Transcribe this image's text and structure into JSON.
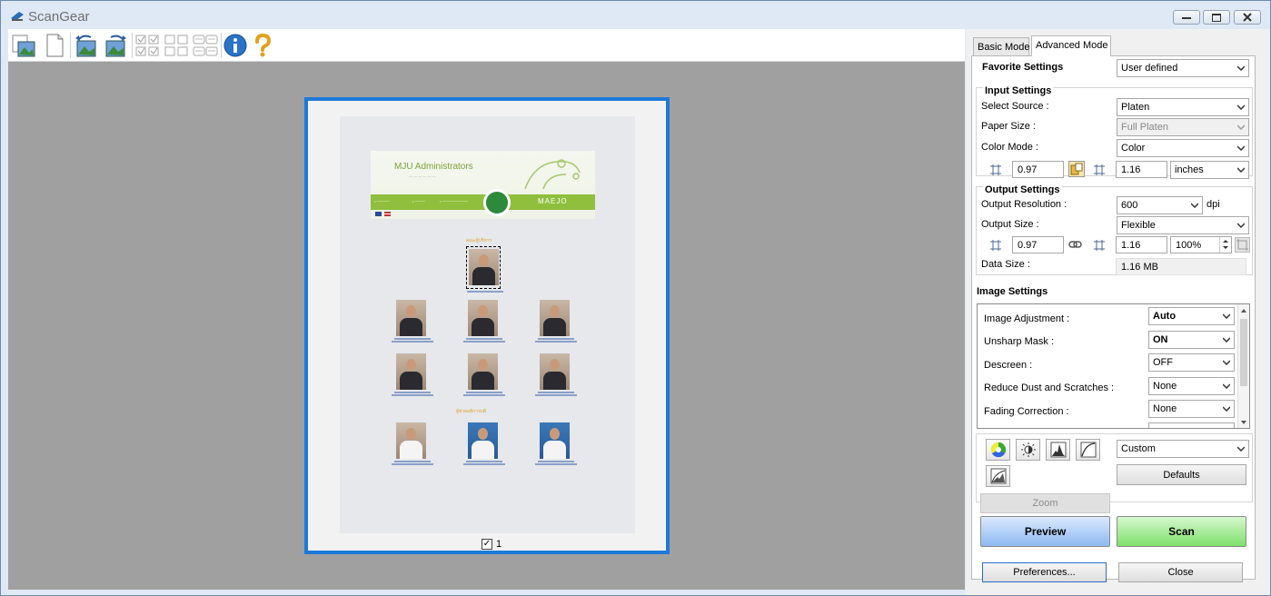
{
  "window": {
    "title": "ScanGear"
  },
  "toolbar": {
    "icons": [
      "scan-to-image-icon",
      "blank-page-icon",
      "rotate-left-icon",
      "rotate-right-icon",
      "thumbnail-select-icon",
      "thumbnail-clear-icon",
      "thumbnail-layout-icon",
      "info-icon",
      "help-icon"
    ]
  },
  "preview": {
    "frame_number": "1",
    "frame_checked": true,
    "document": {
      "banner_title": "MJU Administrators",
      "banner_brand": "MAEJO",
      "section1": "คณะผู้บริหาร",
      "section2": "ผู้ช่วยอธิการบดี"
    }
  },
  "panel": {
    "tabs": [
      {
        "label": "Basic Mode",
        "active": false
      },
      {
        "label": "Advanced Mode",
        "active": true
      }
    ],
    "favorite": {
      "label": "Favorite Settings",
      "value": "User defined"
    },
    "input": {
      "title": "Input Settings",
      "source_label": "Select Source :",
      "source_value": "Platen",
      "paper_label": "Paper Size :",
      "paper_value": "Full Platen",
      "color_label": "Color Mode :",
      "color_value": "Color",
      "width": "0.97",
      "height": "1.16",
      "unit": "inches"
    },
    "output": {
      "title": "Output Settings",
      "resolution_label": "Output Resolution :",
      "resolution_value": "600",
      "resolution_unit": "dpi",
      "size_label": "Output Size :",
      "size_value": "Flexible",
      "width": "0.97",
      "height": "1.16",
      "scale": "100%",
      "data_size_label": "Data Size :",
      "data_size_value": "1.16 MB"
    },
    "image": {
      "title": "Image Settings",
      "rows": [
        {
          "label": "Image Adjustment :",
          "value": "Auto",
          "bold": true
        },
        {
          "label": "Unsharp Mask :",
          "value": "ON",
          "bold": true
        },
        {
          "label": "Descreen :",
          "value": "OFF",
          "bold": false
        },
        {
          "label": "Reduce Dust and Scratches :",
          "value": "None",
          "bold": false
        },
        {
          "label": "Fading Correction :",
          "value": "None",
          "bold": false
        }
      ]
    },
    "tone": {
      "preset": "Custom",
      "defaults": "Defaults"
    },
    "buttons": {
      "zoom": "Zoom",
      "preview": "Preview",
      "scan": "Scan",
      "preferences": "Preferences...",
      "close": "Close"
    }
  }
}
